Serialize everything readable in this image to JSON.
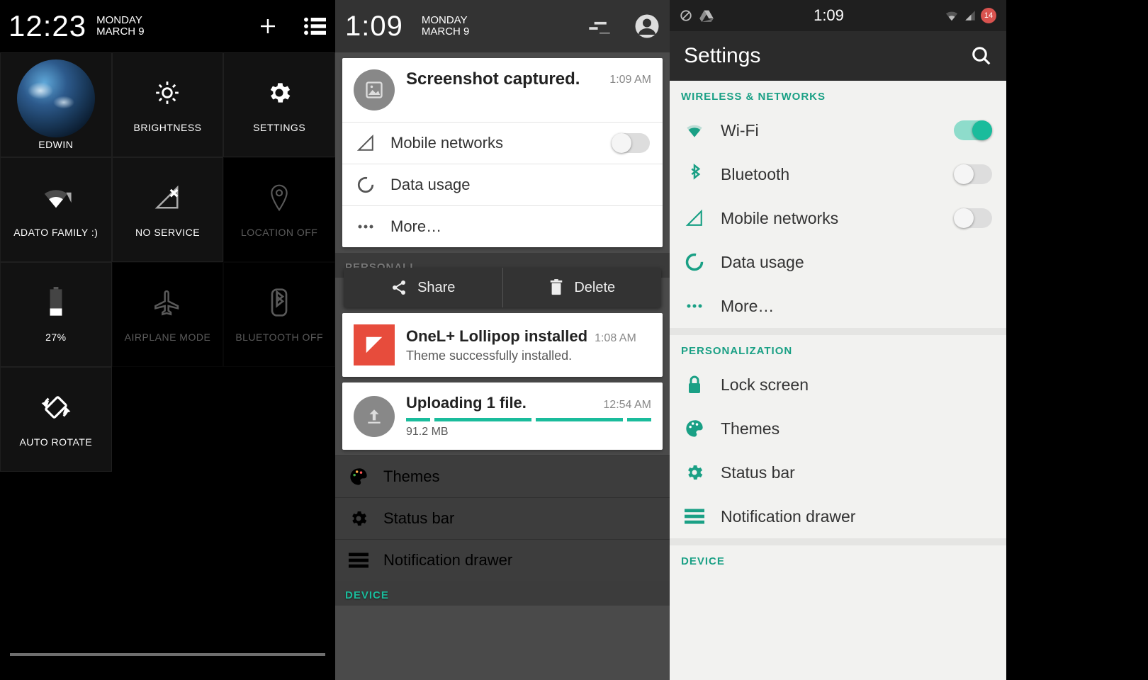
{
  "p1": {
    "clock": "12:23",
    "day": "MONDAY",
    "date": "MARCH 9",
    "tiles": {
      "profile": "EDWIN",
      "brightness": "BRIGHTNESS",
      "settings": "SETTINGS",
      "wifi": "ADATO FAMILY :)",
      "signal": "NO SERVICE",
      "location": "LOCATION OFF",
      "battery": "27%",
      "airplane": "AIRPLANE MODE",
      "bluetooth": "BLUETOOTH OFF",
      "rotate": "AUTO ROTATE"
    }
  },
  "p2": {
    "clock": "1:09",
    "day": "MONDAY",
    "date": "MARCH 9",
    "notif_screenshot": {
      "title": "Screenshot captured.",
      "time": "1:09 AM"
    },
    "rows": {
      "mobile": "Mobile networks",
      "data": "Data usage",
      "more": "More…"
    },
    "actions": {
      "share": "Share",
      "delete": "Delete"
    },
    "notif_theme": {
      "title": "OneL+ Lollipop installed",
      "sub": "Theme successfully installed.",
      "time": "1:08 AM"
    },
    "notif_upload": {
      "title": "Uploading 1 file.",
      "size": "91.2 MB",
      "time": "12:54 AM"
    },
    "bg": {
      "personalization": "PERSONALI",
      "themes": "Themes",
      "statusbar": "Status bar",
      "drawer": "Notification drawer",
      "device": "DEVICE"
    }
  },
  "p3": {
    "status_time": "1:09",
    "badge": "14",
    "title": "Settings",
    "s_wireless": "WIRELESS & NETWORKS",
    "wifi": "Wi-Fi",
    "bluetooth": "Bluetooth",
    "mobile": "Mobile networks",
    "data": "Data usage",
    "more": "More…",
    "s_personal": "PERSONALIZATION",
    "lock": "Lock screen",
    "themes": "Themes",
    "statusbar": "Status bar",
    "drawer": "Notification drawer",
    "s_device": "DEVICE"
  }
}
